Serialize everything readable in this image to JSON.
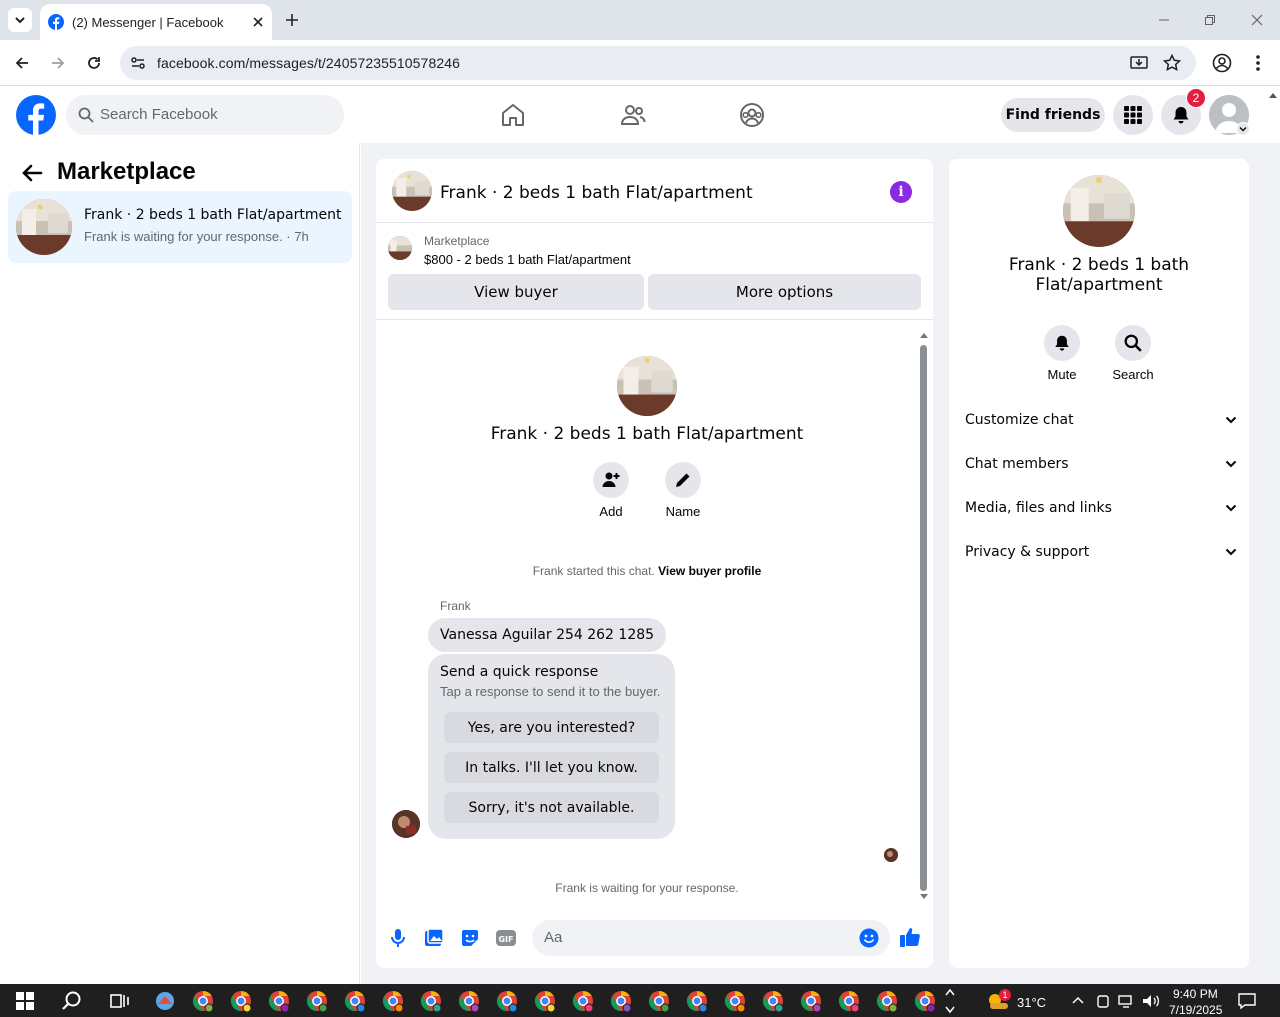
{
  "browser": {
    "tab_title": "(2) Messenger | Facebook",
    "url": "facebook.com/messages/t/24057235510578246"
  },
  "fb": {
    "search_placeholder": "Search Facebook",
    "find_friends": "Find friends",
    "notif_count": "2",
    "brand_color": "#0866ff"
  },
  "left": {
    "title": "Marketplace",
    "conversation": {
      "name": "Frank · 2 beds 1 bath Flat/apartment",
      "preview": "Frank is waiting for your response. · 7h"
    }
  },
  "chat": {
    "header_name": "Frank · 2 beds 1 bath Flat/apartment",
    "marketplace_label": "Marketplace",
    "listing": "$800 - 2 beds 1 bath Flat/apartment",
    "view_buyer": "View buyer",
    "more_options": "More options",
    "intro_name": "Frank · 2 beds 1 bath Flat/apartment",
    "add_label": "Add",
    "name_label": "Name",
    "started_text": "Frank started this chat.",
    "view_buyer_profile": "View buyer profile",
    "sender": "Frank",
    "message": "Vanessa Aguilar 254 262 1285",
    "quick_title": "Send a quick response",
    "quick_sub": "Tap a response to send it to the buyer.",
    "quick_options": [
      "Yes, are you interested?",
      "In talks. I'll let you know.",
      "Sorry, it's not available."
    ],
    "waiting": "Frank is waiting for your response.",
    "composer_placeholder": "Aa"
  },
  "right": {
    "name_line1": "Frank · 2 beds 1 bath",
    "name_line2": "Flat/apartment",
    "mute": "Mute",
    "search": "Search",
    "sections": [
      "Customize chat",
      "Chat members",
      "Media, files and links",
      "Privacy & support"
    ]
  },
  "taskbar": {
    "temp": "31°C",
    "time": "9:40 PM",
    "date": "7/19/2025",
    "weather_badge": "1"
  }
}
